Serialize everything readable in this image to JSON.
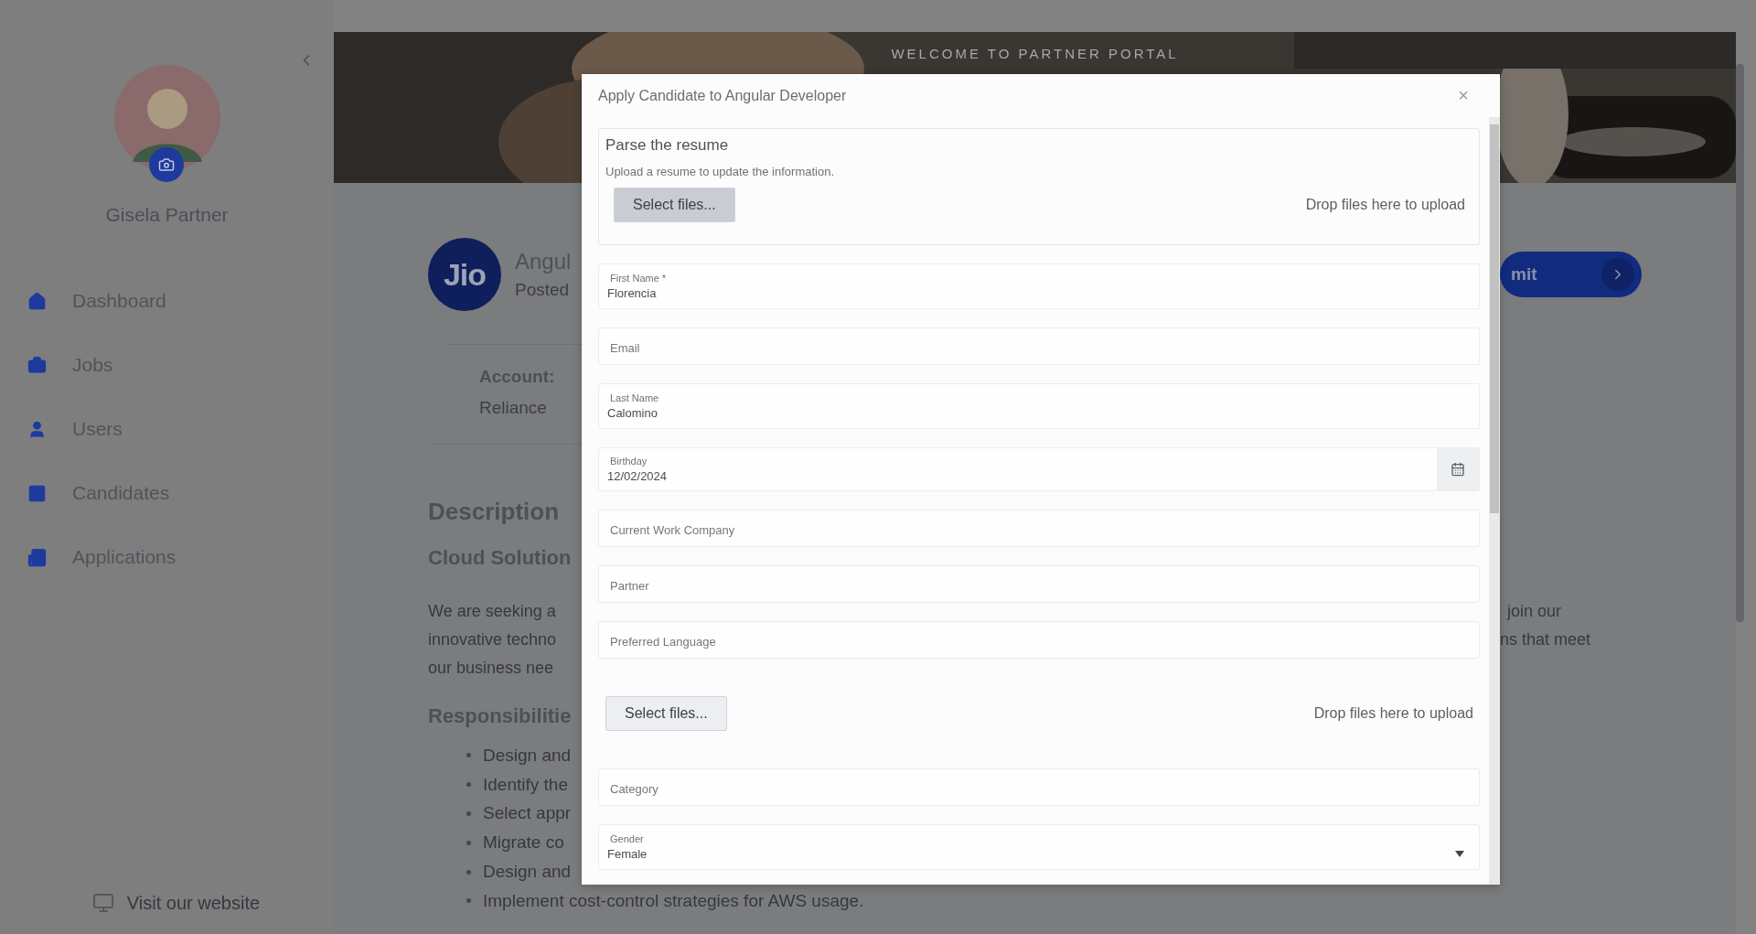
{
  "banner": {
    "title": "WELCOME TO PARTNER PORTAL"
  },
  "sidebar": {
    "user": {
      "name": "Gisela Partner"
    },
    "items": [
      {
        "label": "Dashboard"
      },
      {
        "label": "Jobs"
      },
      {
        "label": "Users"
      },
      {
        "label": "Candidates"
      },
      {
        "label": "Applications"
      }
    ],
    "footer_link": "Visit our website"
  },
  "job": {
    "logo": "Jio",
    "title": "Angul",
    "posted": "Posted",
    "account_label": "Account:",
    "account_value": "Reliance",
    "submit": "mit"
  },
  "description": {
    "heading": "Description",
    "subheading": "Cloud Solution",
    "paragraph_left": [
      "We are seeking a",
      "innovative techno",
      "our business nee"
    ],
    "paragraph_right": [
      "join our",
      "ns that meet"
    ],
    "responsibilities_heading": "Responsibilitie",
    "responsibilities": [
      "Design and",
      "Identify the",
      "Select appr",
      "Migrate co",
      "Design and",
      "Implement cost-control strategies for AWS usage."
    ]
  },
  "dialog": {
    "title": "Apply Candidate to Angular Developer",
    "close": "×",
    "parse": {
      "title": "Parse the resume",
      "hint": "Upload a resume to update the information.",
      "button": "Select files...",
      "drop": "Drop files here to upload"
    },
    "fields": [
      {
        "kind": "text",
        "label": "First Name *",
        "value": "Florencia"
      },
      {
        "kind": "text",
        "placeholder": "Email"
      },
      {
        "kind": "text",
        "label": "Last Name",
        "value": "Calomino"
      },
      {
        "kind": "date",
        "label": "Birthday",
        "value": "12/02/2024"
      },
      {
        "kind": "text",
        "placeholder": "Current Work Company"
      },
      {
        "kind": "text",
        "placeholder": "Partner"
      },
      {
        "kind": "text",
        "placeholder": "Preferred Language"
      },
      {
        "kind": "upload",
        "button": "Select files...",
        "drop": "Drop files here to upload"
      },
      {
        "kind": "text",
        "placeholder": "Category"
      },
      {
        "kind": "select",
        "label": "Gender",
        "value": "Female"
      }
    ]
  }
}
